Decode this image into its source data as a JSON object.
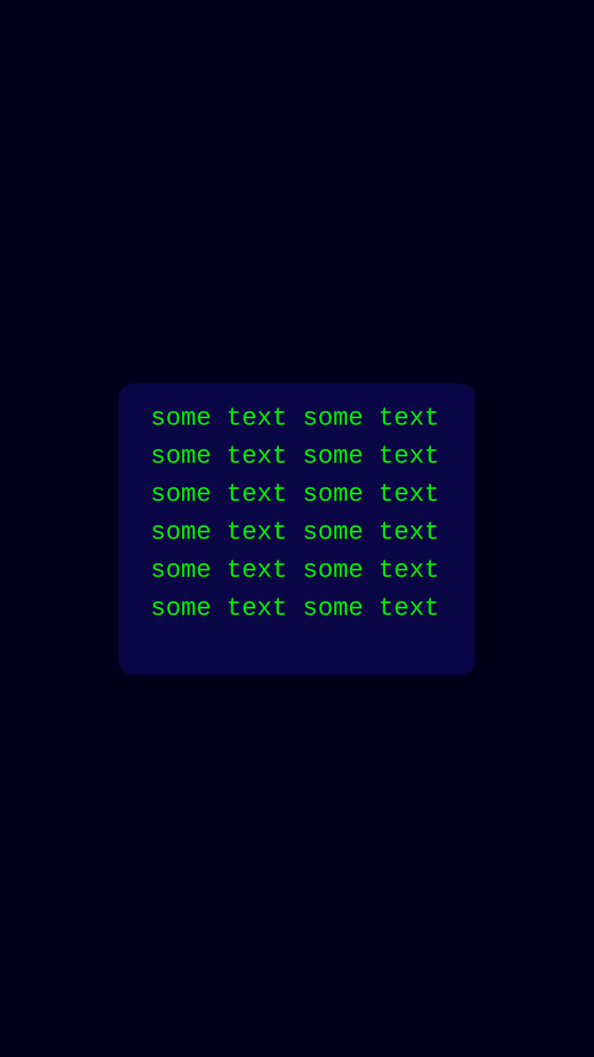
{
  "card": {
    "lines": [
      "some text some text",
      "some text some text",
      "some text some text",
      "some text some text",
      "some text some text",
      "some text some text"
    ]
  },
  "colors": {
    "background": "#00001a",
    "card_background": "#0a0645",
    "text": "#00ee00"
  }
}
